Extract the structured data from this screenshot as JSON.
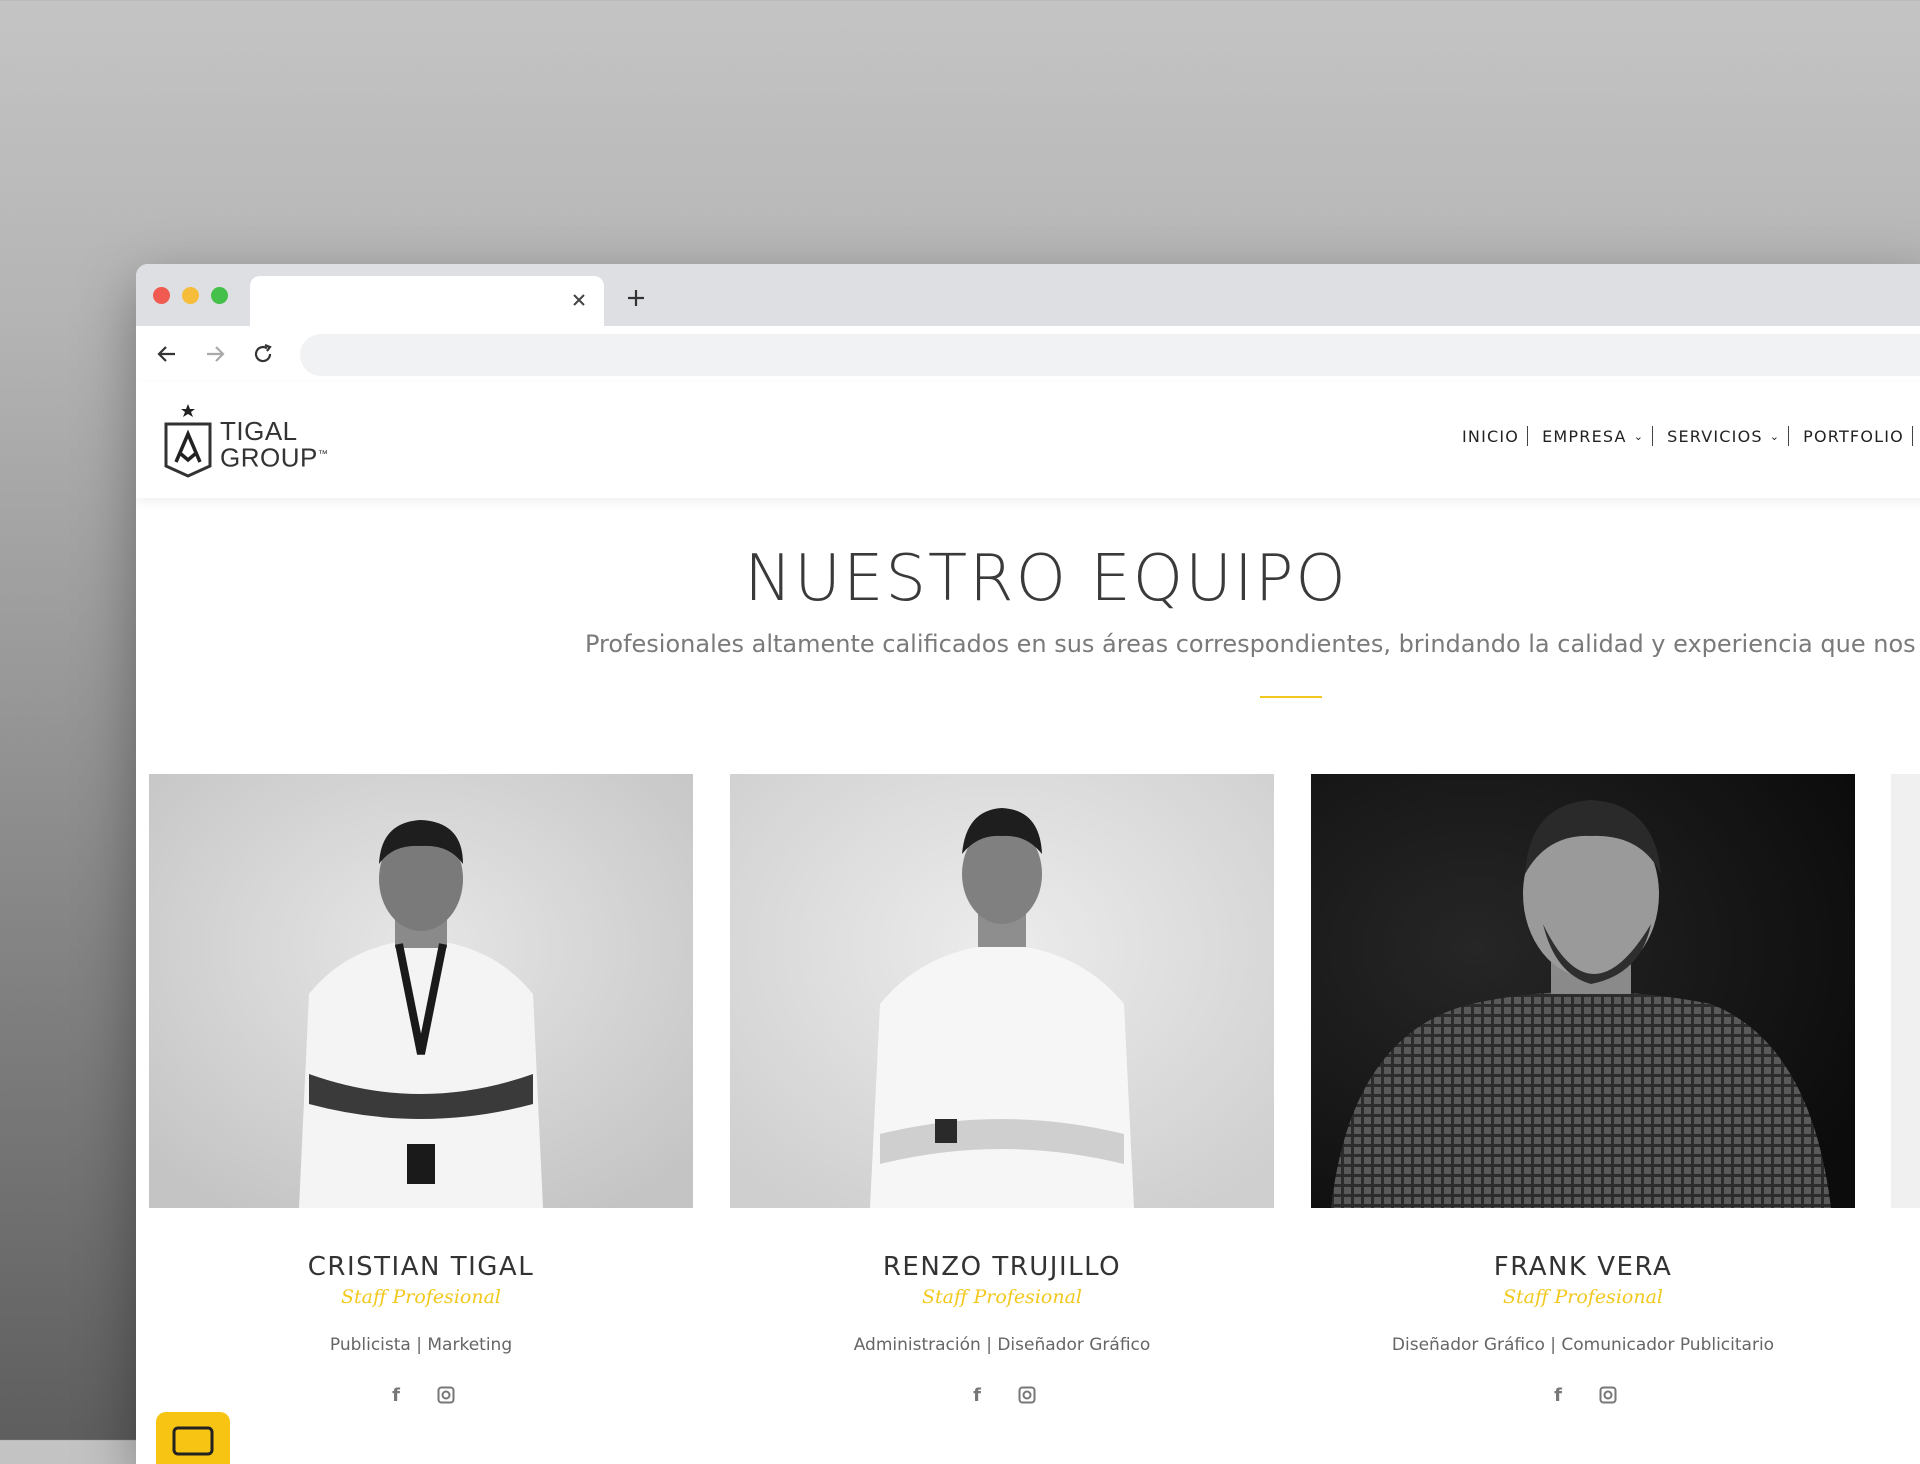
{
  "browser": {
    "tab_title": "",
    "address": ""
  },
  "site": {
    "logo_line1": "TIGAL",
    "logo_line2": "GROUP",
    "logo_tm": "™",
    "nav": [
      {
        "label": "INICIO",
        "has_dropdown": false
      },
      {
        "label": "EMPRESA",
        "has_dropdown": true
      },
      {
        "label": "SERVICIOS",
        "has_dropdown": true
      },
      {
        "label": "PORTFOLIO",
        "has_dropdown": false
      }
    ]
  },
  "team": {
    "title": "NUESTRO EQUIPO",
    "subtitle": "Profesionales altamente calificados en sus áreas correspondientes, brindando la calidad y experiencia que nos cara",
    "members": [
      {
        "name": "CRISTIAN TIGAL",
        "role": "Staff Profesional",
        "description": "Publicista | Marketing"
      },
      {
        "name": "RENZO TRUJILLO",
        "role": "Staff Profesional",
        "description": "Administración | Diseñador Gráfico"
      },
      {
        "name": "FRANK VERA",
        "role": "Staff Profesional",
        "description": "Diseñador Gráfico | Comunicador Publicitario"
      }
    ]
  },
  "colors": {
    "accent": "#f2c81e",
    "chat_button": "#f7c414"
  },
  "icons": [
    "close-icon",
    "plus-icon",
    "back-arrow-icon",
    "forward-arrow-icon",
    "reload-icon",
    "facebook-icon",
    "instagram-icon",
    "chat-icon"
  ]
}
